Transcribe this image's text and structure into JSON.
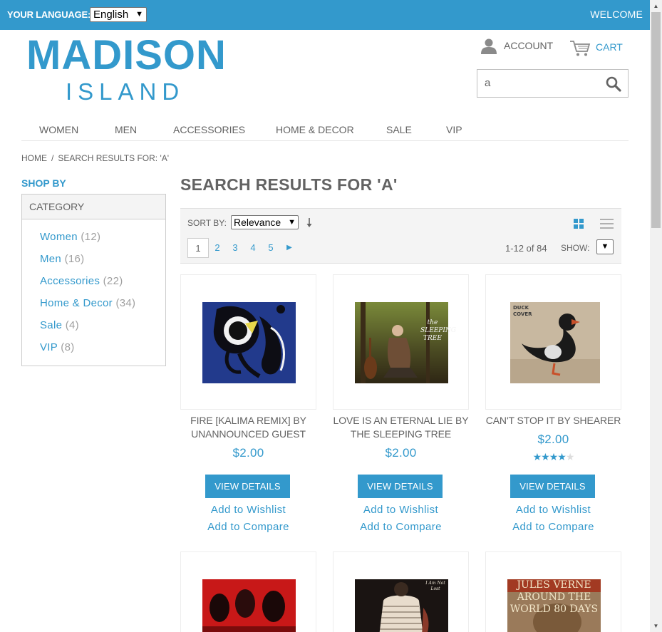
{
  "header": {
    "language_label": "YOUR LANGUAGE:",
    "language_value": "English",
    "welcome": "WELCOME"
  },
  "logo": {
    "main": "MADISON",
    "sub": "ISLAND"
  },
  "account": {
    "label": "ACCOUNT",
    "icon": "user-icon"
  },
  "cart": {
    "label": "CART",
    "icon": "cart-icon"
  },
  "search": {
    "value": "a",
    "icon": "search-icon"
  },
  "nav": [
    "WOMEN",
    "MEN",
    "ACCESSORIES",
    "HOME & DECOR",
    "SALE",
    "VIP"
  ],
  "breadcrumb": {
    "home": "HOME",
    "separator": "/",
    "current": "SEARCH RESULTS FOR: 'A'"
  },
  "sidebar": {
    "shop_by": "SHOP BY",
    "category_title": "CATEGORY",
    "categories": [
      {
        "label": "Women",
        "count": "(12)"
      },
      {
        "label": "Men",
        "count": "(16)"
      },
      {
        "label": "Accessories",
        "count": "(22)"
      },
      {
        "label": "Home & Decor",
        "count": "(34)"
      },
      {
        "label": "Sale",
        "count": "(4)"
      },
      {
        "label": "VIP",
        "count": "(8)"
      }
    ]
  },
  "main": {
    "title": "SEARCH RESULTS FOR 'A'",
    "sort_label": "SORT BY:",
    "sort_value": "Relevance",
    "pages": [
      "1",
      "2",
      "3",
      "4",
      "5"
    ],
    "current_page": "1",
    "count_text": "1-12 of 84",
    "show_label": "SHOW:"
  },
  "products": [
    {
      "name": "FIRE [KALIMA REMIX] BY UNANNOUNCED GUEST",
      "price": "$2.00",
      "rating": null,
      "button": "VIEW DETAILS",
      "wishlist": "Add to Wishlist",
      "compare": "Add to Compare"
    },
    {
      "name": "LOVE IS AN ETERNAL LIE BY THE SLEEPING TREE",
      "price": "$2.00",
      "rating": null,
      "button": "VIEW DETAILS",
      "wishlist": "Add to Wishlist",
      "compare": "Add to Compare",
      "art_text": "the SLEEPING TREE"
    },
    {
      "name": "CAN'T STOP IT BY SHEARER",
      "price": "$2.00",
      "rating": 4,
      "rating_max": 5,
      "button": "VIEW DETAILS",
      "wishlist": "Add to Wishlist",
      "compare": "Add to Compare",
      "art_text": "DUCK COVER"
    },
    {
      "name": "",
      "art_text": ""
    },
    {
      "name": "",
      "art_text": "I Am Not Lost"
    },
    {
      "name": "",
      "art_text": "JULES VERNE AROUND THE WORLD 80 DAYS"
    }
  ],
  "colors": {
    "accent": "#3399cc",
    "text": "#636363"
  }
}
